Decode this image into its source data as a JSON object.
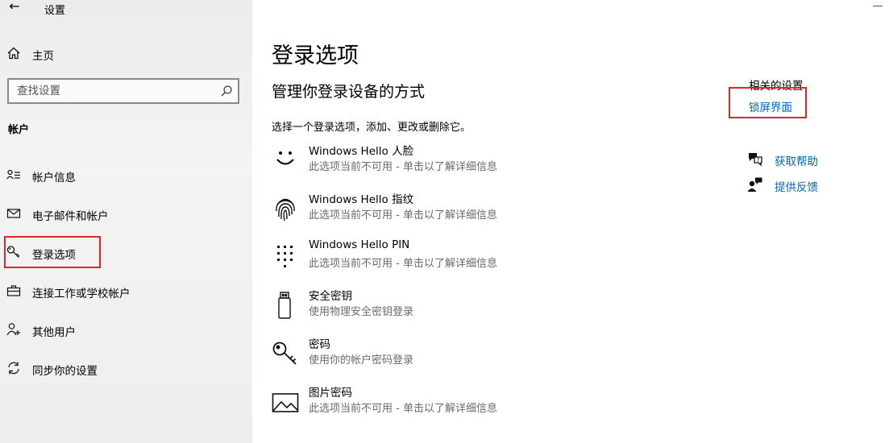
{
  "titlebar": {
    "back_glyph": "←",
    "title": "设置"
  },
  "sidebar": {
    "home_label": "主页",
    "search_placeholder": "查找设置",
    "section_header": "帐户",
    "items": [
      {
        "label": "帐户信息",
        "icon": "person-card-icon"
      },
      {
        "label": "电子邮件和帐户",
        "icon": "mail-icon"
      },
      {
        "label": "登录选项",
        "icon": "key-icon",
        "selected": true
      },
      {
        "label": "连接工作或学校帐户",
        "icon": "briefcase-icon"
      },
      {
        "label": "其他用户",
        "icon": "add-person-icon"
      },
      {
        "label": "同步你的设置",
        "icon": "sync-icon"
      }
    ]
  },
  "main": {
    "title": "登录选项",
    "subtitle": "管理你登录设备的方式",
    "description": "选择一个登录选项，添加、更改或删除它。",
    "options": [
      {
        "title": "Windows Hello 人脸",
        "subtitle": "此选项当前不可用 - 单击以了解详细信息",
        "icon": "face-icon"
      },
      {
        "title": "Windows Hello 指纹",
        "subtitle": "此选项当前不可用 - 单击以了解详细信息",
        "icon": "fingerprint-icon"
      },
      {
        "title": "Windows Hello PIN",
        "subtitle": "此选项当前不可用 - 单击以了解详细信息",
        "icon": "pin-keypad-icon"
      },
      {
        "title": "安全密钥",
        "subtitle": "使用物理安全密钥登录",
        "icon": "usb-key-icon"
      },
      {
        "title": "密码",
        "subtitle": "使用你的帐户密码登录",
        "icon": "password-key-icon"
      },
      {
        "title": "图片密码",
        "subtitle": "此选项当前不可用 - 单击以了解详细信息",
        "icon": "picture-icon"
      }
    ]
  },
  "related": {
    "title": "相关的设置",
    "lock_screen_link": "锁屏界面",
    "get_help_link": "获取帮助",
    "feedback_link": "提供反馈"
  },
  "colors": {
    "link": "#0066b4",
    "highlight_border": "#e0262a",
    "sidebar_bg": "#f1f1f1"
  }
}
